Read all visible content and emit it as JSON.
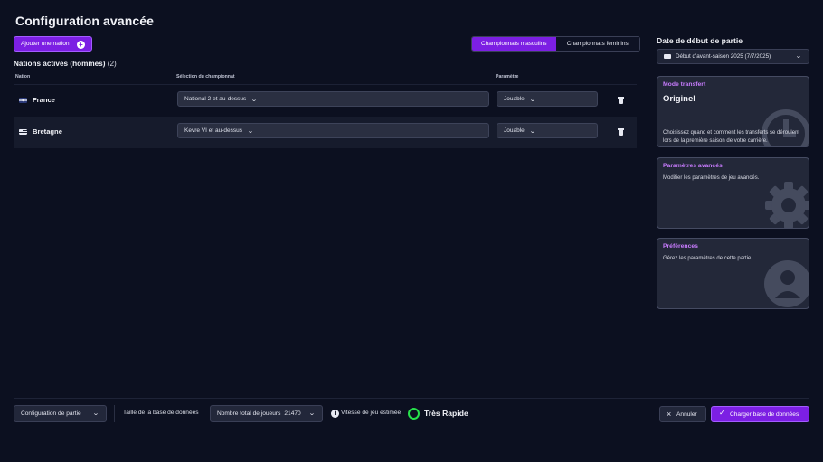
{
  "page": {
    "title": "Configuration avancée"
  },
  "toolbar": {
    "add_nation_label": "Ajouter une nation",
    "gender_tabs": [
      {
        "label": "Championnats masculins",
        "active": true
      },
      {
        "label": "Championnats féminins",
        "active": false
      }
    ]
  },
  "nations": {
    "section_title": "Nations actives (hommes)",
    "count": "(2)",
    "columns": [
      "Nation",
      "Sélection du championnat",
      "Paramètre"
    ],
    "rows": [
      {
        "name": "France",
        "league": "National 2 et au-dessus",
        "setting": "Jouable",
        "flag_icon": "flag-icon"
      },
      {
        "name": "Bretagne",
        "league": "Kevre VI et au-dessus",
        "setting": "Jouable",
        "flag_icon": "flag-icon"
      }
    ]
  },
  "sidebar": {
    "start_date_title": "Date de début de partie",
    "start_date_value": "Début d'avant-saison 2025 (7/7/2025)",
    "cards": [
      {
        "kicker": "Mode transfert",
        "value": "Originel",
        "description": "Choisissez quand et comment les transferts se déroulent lors de la première saison de votre carrière.",
        "icon": "clock-icon"
      },
      {
        "kicker": "Paramètres avancés",
        "value": "",
        "description": "Modifier les paramètres de jeu avancés.",
        "icon": "gear-icon"
      },
      {
        "kicker": "Préférences",
        "value": "",
        "description": "Gérez les paramètres de cette partie.",
        "icon": "user-icon"
      }
    ]
  },
  "footer": {
    "config_select": "Configuration de partie",
    "db_size_label": "Taille de la base de données",
    "db_size_select": "Nombre total de joueurs",
    "db_size_value": "21470",
    "speed_label": "Vitesse de jeu estimée",
    "speed_value": "Très Rapide",
    "cancel_label": "Annuler",
    "load_label": "Charger base de données"
  },
  "colors": {
    "accent": "#7c1fe3",
    "card_kicker": "#c97cff",
    "speed_indicator": "#27e04b",
    "background": "#0c1020"
  }
}
